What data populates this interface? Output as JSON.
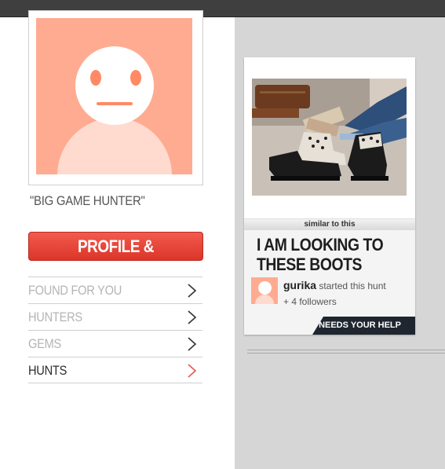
{
  "profile": {
    "username": "\"BIG GAME HUNTER\"",
    "settings_button": "PROFILE & SETTINGS"
  },
  "nav": {
    "items": [
      {
        "label": "FOUND FOR YOU",
        "active": false,
        "icon": "chevron-right-icon"
      },
      {
        "label": "HUNTERS",
        "active": false,
        "icon": "chevron-right-icon"
      },
      {
        "label": "GEMS",
        "active": false,
        "icon": "chevron-right-icon"
      },
      {
        "label": "HUNTS",
        "active": true,
        "icon": "chevron-right-icon"
      }
    ]
  },
  "hunt_card": {
    "similar_label": "similar to this",
    "title": "I AM LOOKING TO THESE BOOTS",
    "hunter_name": "gurika",
    "hunter_action": "started this hunt",
    "followers": "+ 4 followers",
    "needs_help": "NEEDS YOUR HELP"
  },
  "colors": {
    "accent": "#e63d32",
    "avatar_bg": "#ffab91",
    "avatar_face": "#ff8a65",
    "topbar": "#3f3f3f",
    "content_bg": "#d6d6d6",
    "badge_bg": "#1f2630"
  }
}
